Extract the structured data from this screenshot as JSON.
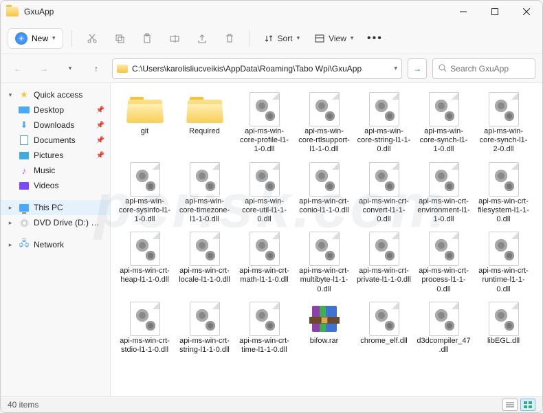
{
  "window": {
    "title": "GxuApp"
  },
  "toolbar": {
    "new_label": "New",
    "sort_label": "Sort",
    "view_label": "View"
  },
  "address": {
    "path": "C:\\Users\\karolisliucveikis\\AppData\\Roaming\\Tabo Wpi\\GxuApp"
  },
  "search": {
    "placeholder": "Search GxuApp"
  },
  "sidebar": {
    "quick": "Quick access",
    "items": [
      {
        "label": "Desktop"
      },
      {
        "label": "Downloads"
      },
      {
        "label": "Documents"
      },
      {
        "label": "Pictures"
      },
      {
        "label": "Music"
      },
      {
        "label": "Videos"
      }
    ],
    "thispc": "This PC",
    "dvd": "DVD Drive (D:) CCCOMA",
    "network": "Network"
  },
  "files": [
    {
      "name": "git",
      "kind": "folder"
    },
    {
      "name": "Required",
      "kind": "folder"
    },
    {
      "name": "api-ms-win-core-profile-l1-1-0.dll",
      "kind": "dll"
    },
    {
      "name": "api-ms-win-core-rtlsupport-l1-1-0.dll",
      "kind": "dll"
    },
    {
      "name": "api-ms-win-core-string-l1-1-0.dll",
      "kind": "dll"
    },
    {
      "name": "api-ms-win-core-synch-l1-1-0.dll",
      "kind": "dll"
    },
    {
      "name": "api-ms-win-core-synch-l1-2-0.dll",
      "kind": "dll"
    },
    {
      "name": "api-ms-win-core-sysinfo-l1-1-0.dll",
      "kind": "dll"
    },
    {
      "name": "api-ms-win-core-timezone-l1-1-0.dll",
      "kind": "dll"
    },
    {
      "name": "api-ms-win-core-util-l1-1-0.dll",
      "kind": "dll"
    },
    {
      "name": "api-ms-win-crt-conio-l1-1-0.dll",
      "kind": "dll"
    },
    {
      "name": "api-ms-win-crt-convert-l1-1-0.dll",
      "kind": "dll"
    },
    {
      "name": "api-ms-win-crt-environment-l1-1-0.dll",
      "kind": "dll"
    },
    {
      "name": "api-ms-win-crt-filesystem-l1-1-0.dll",
      "kind": "dll"
    },
    {
      "name": "api-ms-win-crt-heap-l1-1-0.dll",
      "kind": "dll"
    },
    {
      "name": "api-ms-win-crt-locale-l1-1-0.dll",
      "kind": "dll"
    },
    {
      "name": "api-ms-win-crt-math-l1-1-0.dll",
      "kind": "dll"
    },
    {
      "name": "api-ms-win-crt-multibyte-l1-1-0.dll",
      "kind": "dll"
    },
    {
      "name": "api-ms-win-crt-private-l1-1-0.dll",
      "kind": "dll"
    },
    {
      "name": "api-ms-win-crt-process-l1-1-0.dll",
      "kind": "dll"
    },
    {
      "name": "api-ms-win-crt-runtime-l1-1-0.dll",
      "kind": "dll"
    },
    {
      "name": "api-ms-win-crt-stdio-l1-1-0.dll",
      "kind": "dll"
    },
    {
      "name": "api-ms-win-crt-string-l1-1-0.dll",
      "kind": "dll"
    },
    {
      "name": "api-ms-win-crt-time-l1-1-0.dll",
      "kind": "dll"
    },
    {
      "name": "bifow.rar",
      "kind": "rar"
    },
    {
      "name": "chrome_elf.dll",
      "kind": "dll"
    },
    {
      "name": "d3dcompiler_47.dll",
      "kind": "dll"
    },
    {
      "name": "libEGL.dll",
      "kind": "dll"
    }
  ],
  "status": {
    "count": "40 items"
  },
  "watermark": "pcrisk.com"
}
